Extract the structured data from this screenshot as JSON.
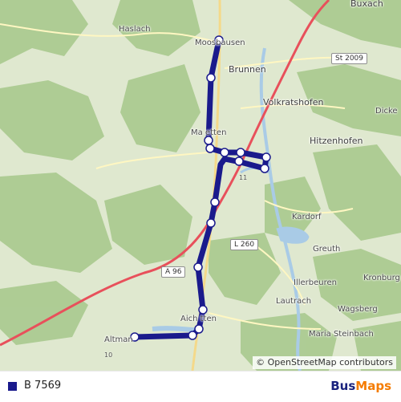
{
  "map": {
    "places": [
      {
        "key": "buxach",
        "label": "Buxach",
        "cls": "town"
      },
      {
        "key": "haslach",
        "label": "Haslach",
        "cls": "village"
      },
      {
        "key": "moosbausen",
        "label": "Moosbausen",
        "cls": "village"
      },
      {
        "key": "brunnen",
        "label": "Brunnen",
        "cls": "town"
      },
      {
        "key": "volkratshofen",
        "label": "Volkratshofen",
        "cls": "town"
      },
      {
        "key": "dicke",
        "label": "Dicke",
        "cls": "village"
      },
      {
        "key": "hitzenhofen",
        "label": "Hitzenhofen",
        "cls": "town"
      },
      {
        "key": "mammetten",
        "label": "Ma   etten",
        "cls": "village"
      },
      {
        "key": "kardorf",
        "label": "Kardorf",
        "cls": "village"
      },
      {
        "key": "greuth",
        "label": "Greuth",
        "cls": "village"
      },
      {
        "key": "kronburg",
        "label": "Kronburg",
        "cls": "village"
      },
      {
        "key": "illerbeuren",
        "label": "Illerbeuren",
        "cls": "village"
      },
      {
        "key": "lautrach",
        "label": "Lautrach",
        "cls": "village"
      },
      {
        "key": "wagsberg",
        "label": "Wagsberg",
        "cls": "village"
      },
      {
        "key": "aichstetten",
        "label": "Aich  tten",
        "cls": "village"
      },
      {
        "key": "maria_steinbach",
        "label": "Maria Steinbach",
        "cls": "village"
      },
      {
        "key": "altmannshofen",
        "label": "Altman",
        "cls": "village"
      }
    ],
    "road_shields": [
      {
        "key": "st2009",
        "label": "St 2009"
      },
      {
        "key": "a96",
        "label": "A 96"
      },
      {
        "key": "l260",
        "label": "L 260"
      }
    ],
    "route_numbers": [
      {
        "key": "r11",
        "label": "11"
      },
      {
        "key": "r10",
        "label": "10"
      }
    ],
    "attribution": "© OpenStreetMap contributors",
    "route_color": "#1a1a8c",
    "forest_color": "#a9c98e",
    "field_color": "#dfe8cf",
    "water_color": "#a9cbe6",
    "highway_color": "#e8505b"
  },
  "footer": {
    "legend_label": "B 7569",
    "legend_color": "#1a1a8c",
    "brand_part1": "Bus",
    "brand_part2": "Maps"
  }
}
